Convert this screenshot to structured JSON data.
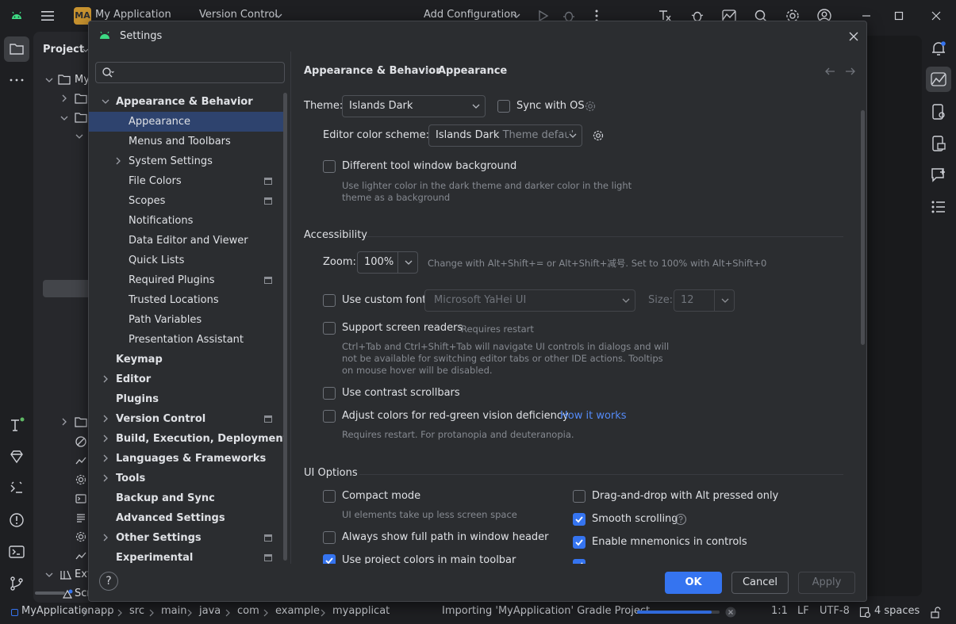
{
  "ide": {
    "project_badge": "MA",
    "project_name": "My Application",
    "vcs": "Version Control",
    "run_config": "Add Configuration",
    "panel_title": "Project",
    "tree_root_label": "My",
    "tree_ext_label": "Ext",
    "tree_scr_label": "Scr"
  },
  "statusbar": {
    "breadcrumb": [
      "MyApplication",
      "app",
      "src",
      "main",
      "java",
      "com",
      "example",
      "myapplicat"
    ],
    "task": "Importing 'MyApplication' Gradle Project",
    "task_progress": 0.9,
    "position": "1:1",
    "line_sep": "LF",
    "encoding": "UTF-8",
    "indent": "4 spaces"
  },
  "dialog": {
    "title": "Settings",
    "search_placeholder": "",
    "breadcrumb_parent": "Appearance & Behavior",
    "breadcrumb_sep": "›",
    "breadcrumb_current": "Appearance",
    "tree": [
      {
        "label": "Appearance & Behavior",
        "level": 0,
        "chevron": "down",
        "bold": true
      },
      {
        "label": "Appearance",
        "level": 1,
        "selected": true
      },
      {
        "label": "Menus and Toolbars",
        "level": 1
      },
      {
        "label": "System Settings",
        "level": 1,
        "chevron": "right"
      },
      {
        "label": "File Colors",
        "level": 1,
        "badge": true
      },
      {
        "label": "Scopes",
        "level": 1,
        "badge": true
      },
      {
        "label": "Notifications",
        "level": 1
      },
      {
        "label": "Data Editor and Viewer",
        "level": 1
      },
      {
        "label": "Quick Lists",
        "level": 1
      },
      {
        "label": "Required Plugins",
        "level": 1,
        "badge": true
      },
      {
        "label": "Trusted Locations",
        "level": 1
      },
      {
        "label": "Path Variables",
        "level": 1
      },
      {
        "label": "Presentation Assistant",
        "level": 1
      },
      {
        "label": "Keymap",
        "level": 0,
        "bold": true
      },
      {
        "label": "Editor",
        "level": 0,
        "chevron": "right",
        "bold": true
      },
      {
        "label": "Plugins",
        "level": 0,
        "bold": true
      },
      {
        "label": "Version Control",
        "level": 0,
        "chevron": "right",
        "bold": true,
        "badge": true
      },
      {
        "label": "Build, Execution, Deployment",
        "level": 0,
        "chevron": "right",
        "bold": true
      },
      {
        "label": "Languages & Frameworks",
        "level": 0,
        "chevron": "right",
        "bold": true
      },
      {
        "label": "Tools",
        "level": 0,
        "chevron": "right",
        "bold": true
      },
      {
        "label": "Backup and Sync",
        "level": 0,
        "bold": true
      },
      {
        "label": "Advanced Settings",
        "level": 0,
        "bold": true
      },
      {
        "label": "Other Settings",
        "level": 0,
        "chevron": "right",
        "bold": true,
        "badge": true
      },
      {
        "label": "Experimental",
        "level": 0,
        "bold": true,
        "badge": true
      }
    ],
    "theme_label": "Theme:",
    "theme_value": "Islands Dark",
    "sync_os_label": "Sync with OS",
    "sync_os_checked": false,
    "scheme_label": "Editor color scheme:",
    "scheme_value": "Islands Dark",
    "scheme_suffix": "Theme defaul",
    "diff_bg_label": "Different tool window background",
    "diff_bg_checked": false,
    "diff_bg_hint": "Use lighter color in the dark theme and darker color in the light theme as a background",
    "accessibility_title": "Accessibility",
    "zoom_label": "Zoom:",
    "zoom_value": "100%",
    "zoom_hint": "Change with Alt+Shift+= or Alt+Shift+减号. Set to 100% with Alt+Shift+0",
    "custom_font_label": "Use custom font:",
    "custom_font_checked": false,
    "font_value": "Microsoft YaHei UI",
    "size_label": "Size:",
    "size_value": "12",
    "screen_readers_label": "Support screen readers",
    "screen_readers_checked": false,
    "screen_readers_note": "Requires restart",
    "screen_readers_hint": "Ctrl+Tab and Ctrl+Shift+Tab will navigate UI controls in dialogs and will not be available for switching editor tabs or other IDE actions. Tooltips on mouse hover will be disabled.",
    "contrast_label": "Use contrast scrollbars",
    "contrast_checked": false,
    "rg_label": "Adjust colors for red-green vision deficiency",
    "rg_checked": false,
    "rg_link": "How it works",
    "rg_hint": "Requires restart. For protanopia and deuteranopia.",
    "ui_options_title": "UI Options",
    "compact_label": "Compact mode",
    "compact_checked": false,
    "compact_hint": "UI elements take up less screen space",
    "full_path_label": "Always show full path in window header",
    "full_path_checked": false,
    "project_colors_label": "Use project colors in main toolbar",
    "project_colors_checked": true,
    "dnd_label": "Drag-and-drop with Alt pressed only",
    "dnd_checked": false,
    "smooth_label": "Smooth scrolling",
    "smooth_checked": true,
    "mnemonics_label": "Enable mnemonics in controls",
    "mnemonics_checked": true,
    "ok_label": "OK",
    "cancel_label": "Cancel",
    "apply_label": "Apply",
    "accent_color": "#3574f0"
  }
}
